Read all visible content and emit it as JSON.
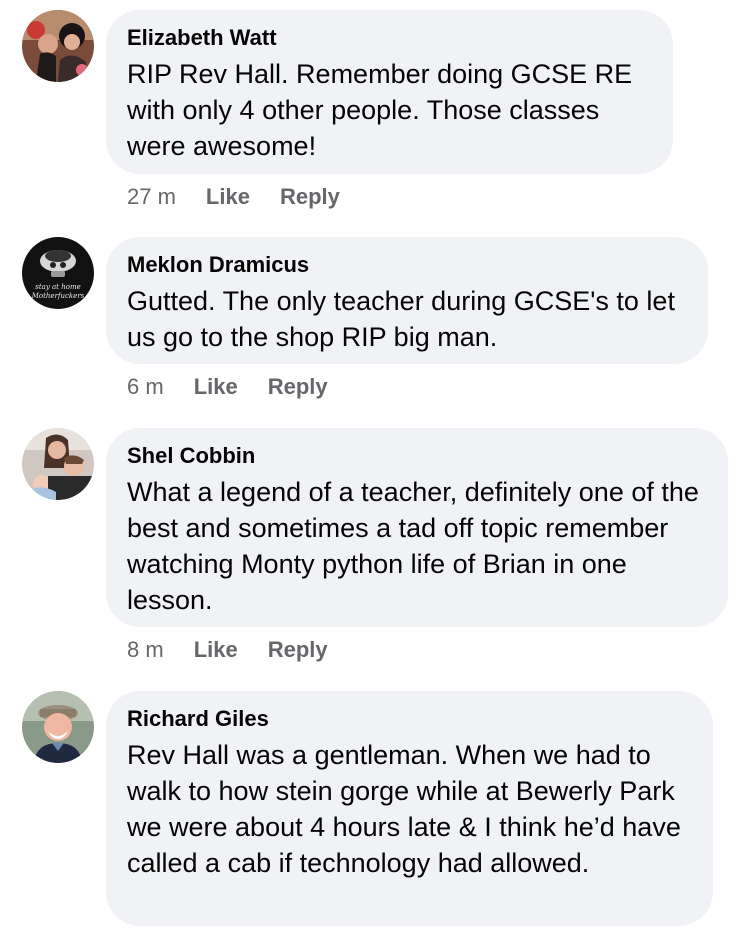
{
  "comments": [
    {
      "author": "Elizabeth Watt",
      "text": "RIP Rev Hall. Remember doing GCSE RE with only 4 other people. Those classes were awesome!",
      "time": "27 m",
      "like_label": "Like",
      "reply_label": "Reply",
      "avatar_icon": "profile-photo"
    },
    {
      "author": "Meklon Dramicus",
      "text": "Gutted. The only teacher during GCSE's to let us go to the shop RIP big man.",
      "time": "6 m",
      "like_label": "Like",
      "reply_label": "Reply",
      "avatar_icon": "profile-photo",
      "avatar_caption": "stay at home Motherfuckers"
    },
    {
      "author": "Shel Cobbin",
      "text": "What a legend of a teacher, definitely one of the best and sometimes a tad off topic remember watching Monty python life of Brian in one lesson.",
      "time": "8 m",
      "like_label": "Like",
      "reply_label": "Reply",
      "avatar_icon": "profile-photo"
    },
    {
      "author": "Richard Giles",
      "text": "Rev Hall was a gentleman. When we had to walk to how stein gorge while at Bewerly Park we were about 4 hours late & I think he’d have called a cab if technology had allowed.",
      "avatar_icon": "profile-photo"
    }
  ]
}
